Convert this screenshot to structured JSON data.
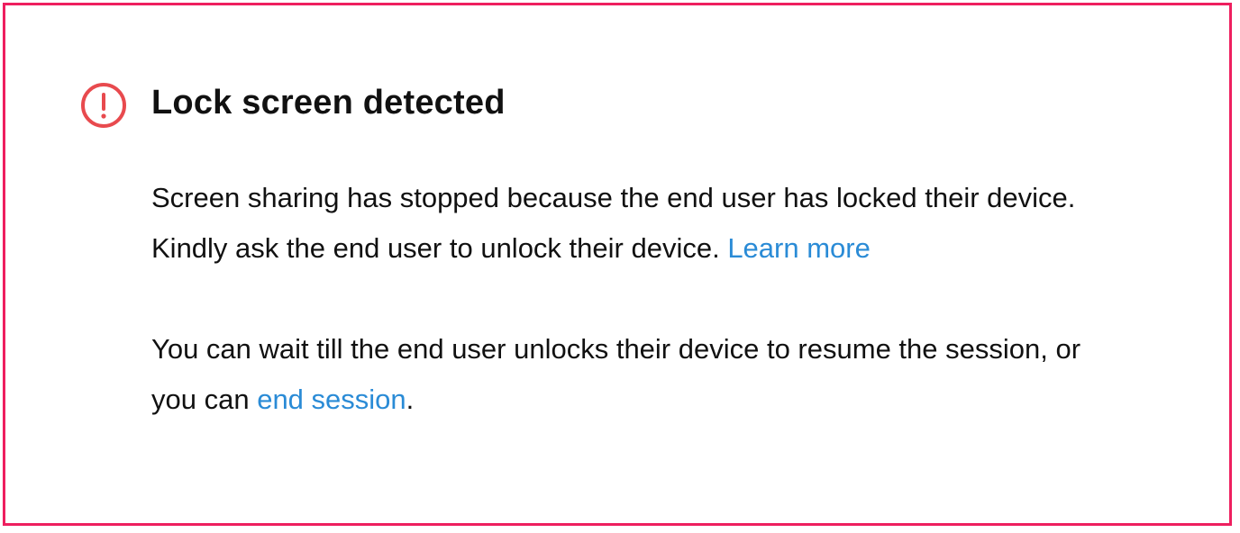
{
  "dialog": {
    "title": "Lock screen detected",
    "icon": "alert-circle-icon",
    "accent_color": "#e84a4e",
    "border_color": "#ee1f5f",
    "link_color": "#2a8bd6",
    "paragraph1": {
      "line1": "Screen sharing has stopped because the end user has locked their device.",
      "line2": "Kindly ask the end user to unlock their device. ",
      "link": "Learn more"
    },
    "paragraph2": {
      "line1": "You can wait till the end user unlocks their device to resume the session, or",
      "line2_prefix": "you can ",
      "link": "end session",
      "line2_suffix": "."
    }
  }
}
